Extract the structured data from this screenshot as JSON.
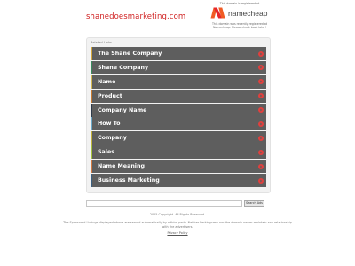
{
  "header": {
    "domain": "shanedoesmarketing.com",
    "registered_note": "This domain is registered at",
    "registrar_logo_text": "namecheap",
    "registrar_note": "This domain was recently registered at Namecheap. Please check back later!",
    "logo_colors": [
      "#f05b24",
      "#e7262b"
    ]
  },
  "related": {
    "label": "Related Links",
    "items": [
      {
        "label": "The Shane Company",
        "accent": "#d4a73a"
      },
      {
        "label": "Shane Company",
        "accent": "#3a8b5e"
      },
      {
        "label": "Name",
        "accent": "#d4b74e"
      },
      {
        "label": "Product",
        "accent": "#c97b30"
      },
      {
        "label": "Company Name",
        "accent": "#2e3a4a"
      },
      {
        "label": "How To",
        "accent": "#6aa8c8"
      },
      {
        "label": "Company",
        "accent": "#c4b23a"
      },
      {
        "label": "Sales",
        "accent": "#a8c43a"
      },
      {
        "label": "Name Meaning",
        "accent": "#d47a40"
      },
      {
        "label": "Business Marketing",
        "accent": "#3b5f80"
      }
    ],
    "arrow_color": "#e0403e"
  },
  "search": {
    "value": "",
    "button_label": "Search Ads"
  },
  "footer": {
    "copyright": "2025 Copyright. All Rights Reserved.",
    "disclaimer": "The Sponsored Listings displayed above are served automatically by a third party. Neither Parkingcrew nor the domain owner maintain any relationship with the advertisers.",
    "privacy": "Privacy Policy"
  }
}
